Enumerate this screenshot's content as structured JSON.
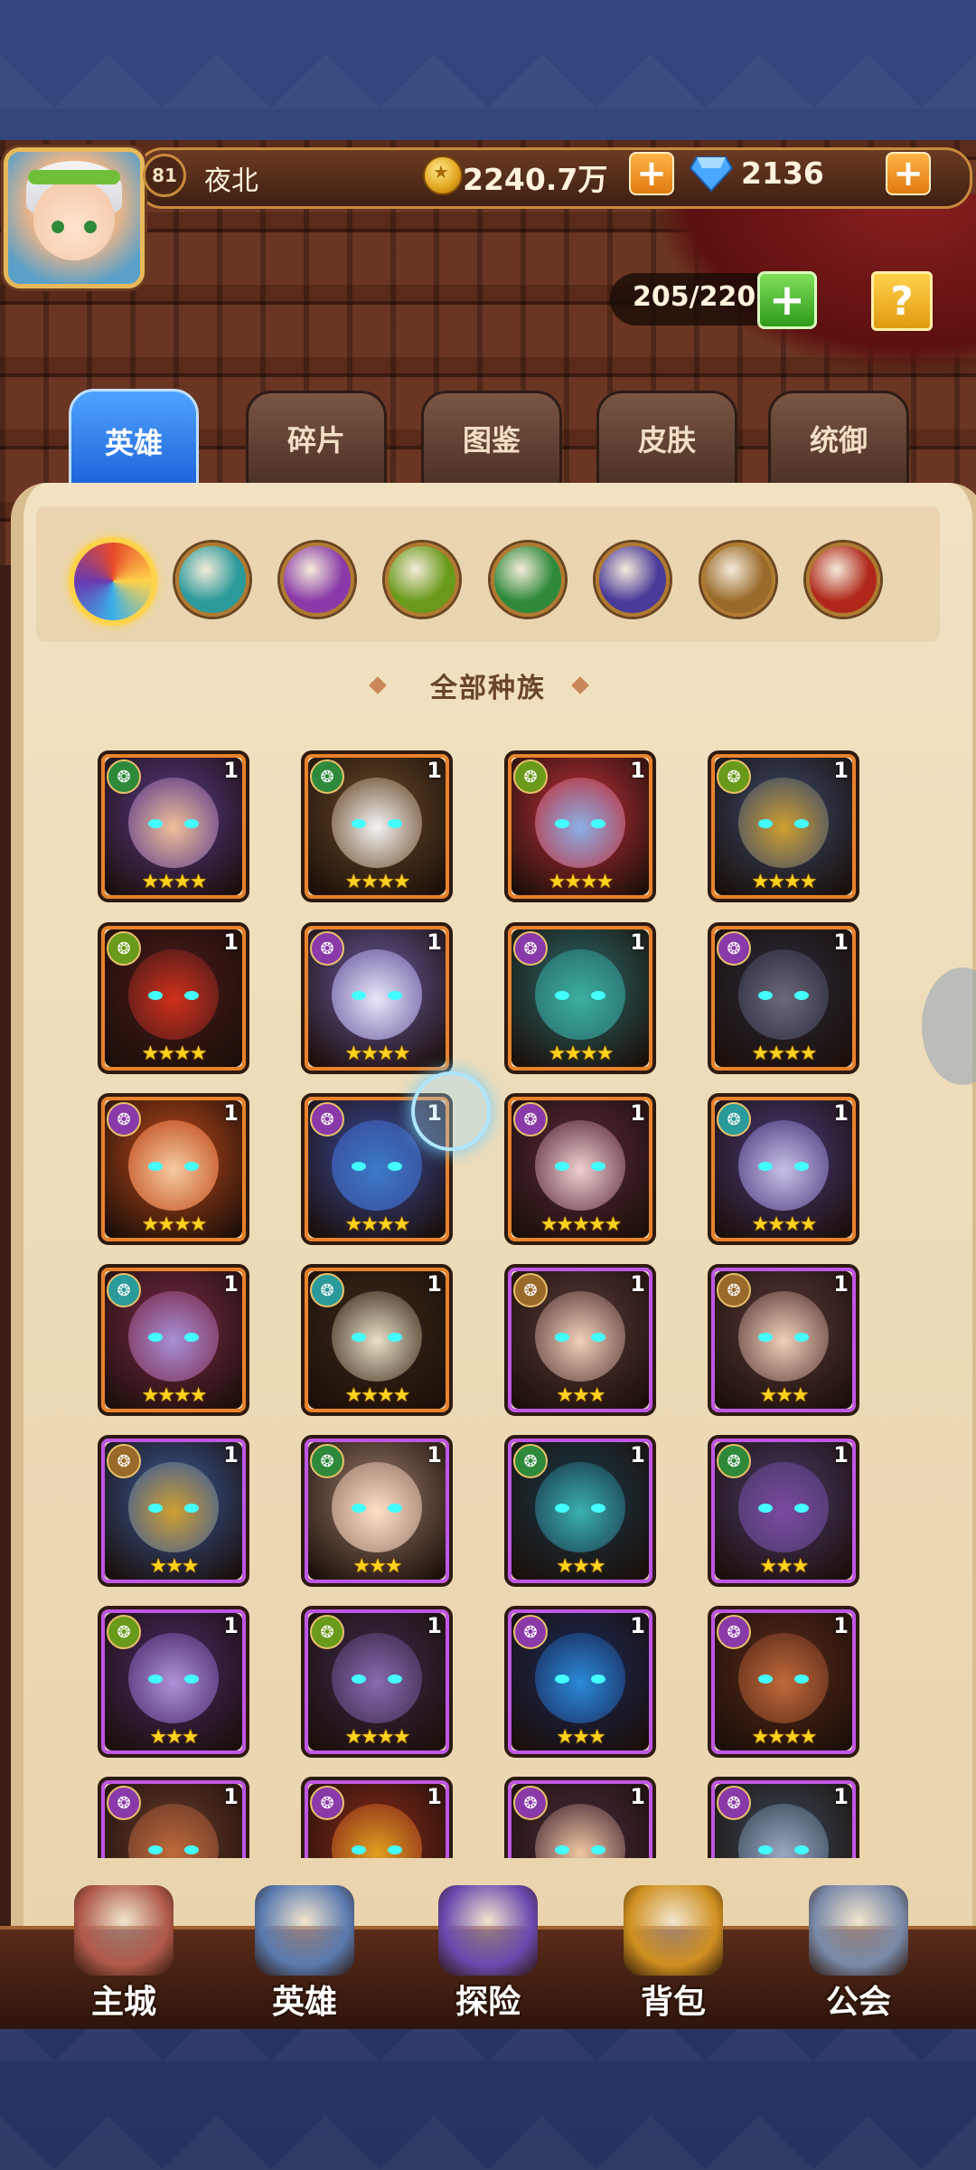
{
  "player": {
    "level": "81",
    "name": "夜北",
    "coins": "2240.7万",
    "gems": "2136"
  },
  "capacity": "205/220",
  "help_label": "?",
  "tabs": [
    {
      "label": "英雄",
      "active": true
    },
    {
      "label": "碎片",
      "active": false
    },
    {
      "label": "图鉴",
      "active": false
    },
    {
      "label": "皮肤",
      "active": false
    },
    {
      "label": "统御",
      "active": false
    }
  ],
  "race_filter": {
    "selected_label": "全部种族",
    "icons": [
      {
        "name": "all-races-icon",
        "color": "#e84a2a"
      },
      {
        "name": "race-teal-icon",
        "color": "#2a9a9a"
      },
      {
        "name": "race-purple-icon",
        "color": "#8a3aa8"
      },
      {
        "name": "race-green-eye-icon",
        "color": "#6a9a1a"
      },
      {
        "name": "race-leaf-icon",
        "color": "#2e8a3a"
      },
      {
        "name": "race-demon-icon",
        "color": "#4a3a9a"
      },
      {
        "name": "race-sun-icon",
        "color": "#9a6a2a"
      },
      {
        "name": "race-fire-icon",
        "color": "#b0281a"
      }
    ]
  },
  "heroes": [
    {
      "level": "1",
      "stars": "★★★★",
      "rarity": "orange",
      "race_color": "#2e8a3a",
      "bg": "#5a3a8a",
      "skin": "#f0c09a"
    },
    {
      "level": "1",
      "stars": "★★★★",
      "rarity": "orange",
      "race_color": "#2e8a3a",
      "bg": "#6a4a2a",
      "skin": "#f4f4f4"
    },
    {
      "level": "1",
      "stars": "★★★★",
      "rarity": "orange",
      "race_color": "#6a9a1a",
      "bg": "#c0303a",
      "skin": "#8ab0e8"
    },
    {
      "level": "1",
      "stars": "★★★★",
      "rarity": "orange",
      "race_color": "#6a9a1a",
      "bg": "#3a4a6a",
      "skin": "#d0a030"
    },
    {
      "level": "1",
      "stars": "★★★★",
      "rarity": "orange",
      "race_color": "#6a9a1a",
      "bg": "#4a1a1a",
      "skin": "#d0301a"
    },
    {
      "level": "1",
      "stars": "★★★★",
      "rarity": "orange",
      "race_color": "#8a3aa8",
      "bg": "#6a5aa0",
      "skin": "#e8e8f8"
    },
    {
      "level": "1",
      "stars": "★★★★",
      "rarity": "orange",
      "race_color": "#8a3aa8",
      "bg": "#2a6a6a",
      "skin": "#3ab0a0"
    },
    {
      "level": "1",
      "stars": "★★★★",
      "rarity": "orange",
      "race_color": "#8a3aa8",
      "bg": "#2a2a3a",
      "skin": "#6a6a7a"
    },
    {
      "level": "1",
      "stars": "★★★★",
      "rarity": "orange",
      "race_color": "#8a3aa8",
      "bg": "#c04a1a",
      "skin": "#f6caa0"
    },
    {
      "level": "1",
      "stars": "★★★★",
      "rarity": "orange",
      "race_color": "#8a3aa8",
      "bg": "#3a4a9a",
      "skin": "#3a7ac8"
    },
    {
      "level": "1",
      "stars": "★★★★★",
      "rarity": "orange",
      "race_color": "#8a3aa8",
      "bg": "#5a2a3a",
      "skin": "#f0d0d0"
    },
    {
      "level": "1",
      "stars": "★★★★",
      "rarity": "orange",
      "race_color": "#2a9a9a",
      "bg": "#4a3a7a",
      "skin": "#c8c0e8"
    },
    {
      "level": "1",
      "stars": "★★★★",
      "rarity": "orange",
      "race_color": "#2a9a9a",
      "bg": "#7a2a4a",
      "skin": "#a890d8"
    },
    {
      "level": "1",
      "stars": "★★★★",
      "rarity": "orange",
      "race_color": "#2a9a9a",
      "bg": "#3a2a1a",
      "skin": "#e8e0c8"
    },
    {
      "level": "1",
      "stars": "★★★",
      "rarity": "purple",
      "race_color": "#9a6a2a",
      "bg": "#5a3a3a",
      "skin": "#f0d0b8"
    },
    {
      "level": "1",
      "stars": "★★★",
      "rarity": "purple",
      "race_color": "#9a6a2a",
      "bg": "#5a3a3a",
      "skin": "#f0d0b8"
    },
    {
      "level": "1",
      "stars": "★★★",
      "rarity": "purple",
      "race_color": "#9a6a2a",
      "bg": "#3a5a9a",
      "skin": "#d0a030"
    },
    {
      "level": "1",
      "stars": "★★★",
      "rarity": "purple",
      "race_color": "#2e8a3a",
      "bg": "#9a7a6a",
      "skin": "#ffe0c8"
    },
    {
      "level": "1",
      "stars": "★★★",
      "rarity": "purple",
      "race_color": "#2e8a3a",
      "bg": "#1a3a4a",
      "skin": "#3ab0b0"
    },
    {
      "level": "1",
      "stars": "★★★",
      "rarity": "purple",
      "race_color": "#2e8a3a",
      "bg": "#4a3a6a",
      "skin": "#7a4aa0"
    },
    {
      "level": "1",
      "stars": "★★★",
      "rarity": "purple",
      "race_color": "#6a9a1a",
      "bg": "#4a2a6a",
      "skin": "#b090d8"
    },
    {
      "level": "1",
      "stars": "★★★★",
      "rarity": "purple",
      "race_color": "#6a9a1a",
      "bg": "#3a2a4a",
      "skin": "#8a6ab0"
    },
    {
      "level": "1",
      "stars": "★★★",
      "rarity": "purple",
      "race_color": "#8a3aa8",
      "bg": "#1a2a5a",
      "skin": "#2a8ad8"
    },
    {
      "level": "1",
      "stars": "★★★★",
      "rarity": "purple",
      "race_color": "#8a3aa8",
      "bg": "#5a2a1a",
      "skin": "#c06a3a"
    },
    {
      "level": "1",
      "stars": "",
      "rarity": "purple",
      "race_color": "#8a3aa8",
      "bg": "#6a3a2a",
      "skin": "#c06a3a"
    },
    {
      "level": "1",
      "stars": "",
      "rarity": "purple",
      "race_color": "#8a3aa8",
      "bg": "#8a2a1a",
      "skin": "#e0a020"
    },
    {
      "level": "1",
      "stars": "",
      "rarity": "purple",
      "race_color": "#8a3aa8",
      "bg": "#4a2a3a",
      "skin": "#f0c8a0"
    },
    {
      "level": "1",
      "stars": "",
      "rarity": "purple",
      "race_color": "#8a3aa8",
      "bg": "#3a4a5a",
      "skin": "#9aa8c0"
    }
  ],
  "bottom_nav": [
    {
      "label": "主城",
      "icon": "castle-icon",
      "color": "#b05a4a"
    },
    {
      "label": "英雄",
      "icon": "hero-portrait-icon",
      "color": "#5a7ab0"
    },
    {
      "label": "探险",
      "icon": "portal-icon",
      "color": "#6a4ab0"
    },
    {
      "label": "背包",
      "icon": "backpack-icon",
      "color": "#d09020"
    },
    {
      "label": "公会",
      "icon": "guild-tower-icon",
      "color": "#7a8aa8"
    }
  ]
}
